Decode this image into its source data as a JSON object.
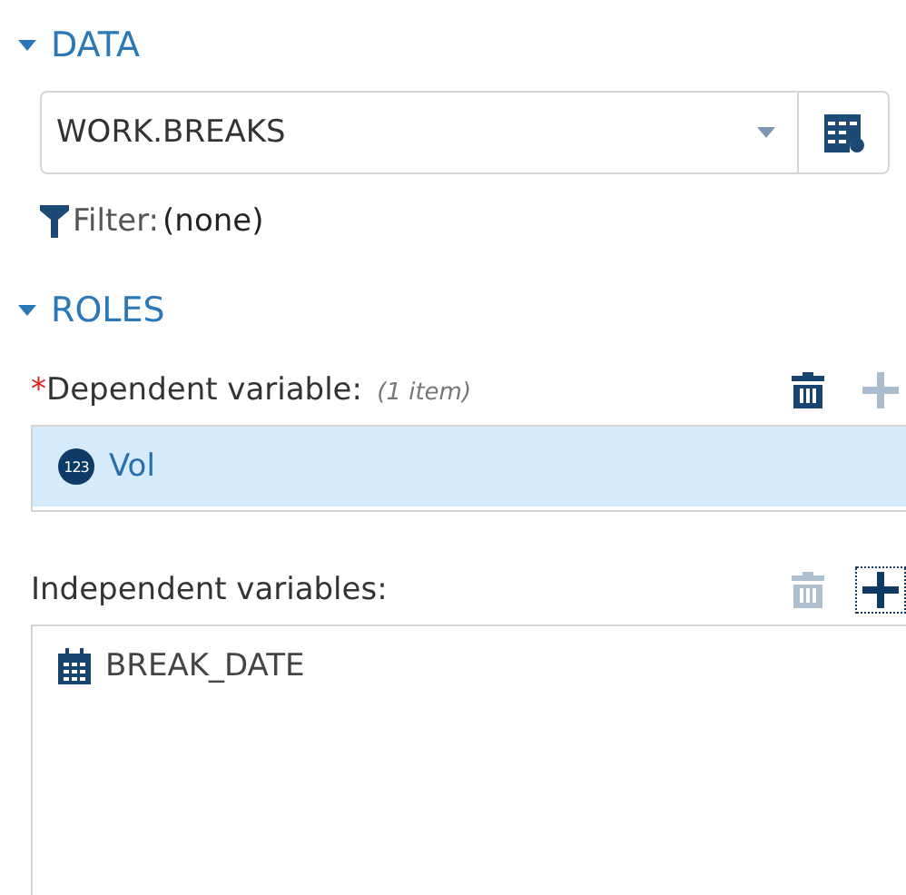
{
  "data_section": {
    "title": "DATA",
    "expanded": true,
    "dataset": "WORK.BREAKS",
    "filter_label": "Filter:",
    "filter_value": "(none)"
  },
  "roles_section": {
    "title": "ROLES",
    "expanded": true,
    "roles": [
      {
        "required": true,
        "required_mark": "*",
        "label": "Dependent variable:",
        "note": "(1 item)",
        "delete_disabled": false,
        "add_disabled": true,
        "add_focused": false,
        "items": [
          {
            "kind": "numeric",
            "icon_text": "123",
            "name": "Vol",
            "selected": true
          }
        ]
      },
      {
        "required": false,
        "label": "Independent variables:",
        "delete_disabled": true,
        "add_disabled": false,
        "add_focused": true,
        "items": [
          {
            "kind": "date",
            "name": "BREAK_DATE",
            "selected": false
          }
        ]
      }
    ]
  }
}
